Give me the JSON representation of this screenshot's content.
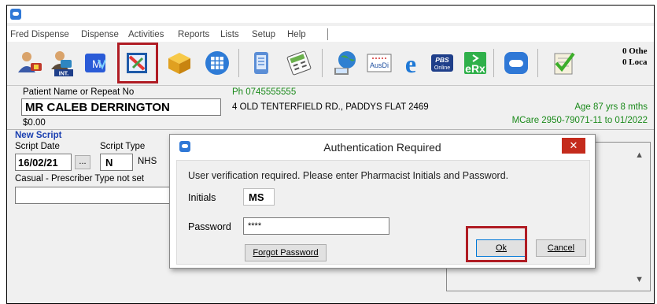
{
  "menu": [
    "Fred Dispense",
    "Dispense",
    "Activities",
    "Reports",
    "Lists",
    "Setup",
    "Help"
  ],
  "toolbar": {
    "icons": [
      {
        "name": "dispense-icon"
      },
      {
        "name": "int-dispense-icon",
        "label": "INT."
      },
      {
        "name": "my-health-record-icon",
        "label": "M"
      },
      {
        "name": "label-print-icon"
      },
      {
        "name": "stock-box-icon"
      },
      {
        "name": "grid-calendar-icon"
      },
      {
        "name": "phone-list-icon"
      },
      {
        "name": "calculator-icon"
      },
      {
        "name": "globe-user-icon"
      },
      {
        "name": "ausdi-icon",
        "label": "AusDi"
      },
      {
        "name": "internet-explorer-icon",
        "label": "e"
      },
      {
        "name": "pbs-online-icon",
        "label": "PBS Online"
      },
      {
        "name": "erx-icon",
        "label": "eRx"
      },
      {
        "name": "fred-logo-icon"
      },
      {
        "name": "checklist-icon"
      }
    ],
    "count1": "0 Othe",
    "count2": "0 Loca"
  },
  "patient": {
    "name_label": "Patient Name or Repeat No",
    "name": "MR CALEB DERRINGTON",
    "balance": "$0.00",
    "phone": "Ph 0745555555",
    "address": "4 OLD TENTERFIELD RD., PADDYS FLAT 2469",
    "age": "Age 87 yrs 8 mths",
    "medicare": "MCare 2950-79071-11  to 01/2022"
  },
  "script": {
    "heading": "New Script",
    "date_label": "Script Date",
    "type_label": "Script Type",
    "date": "16/02/21",
    "browse": "...",
    "type": "N",
    "type_suffix": "NHS",
    "prescriber": "Casual - Prescriber Type not set"
  },
  "dialog": {
    "title": "Authentication Required",
    "close": "✕",
    "message": "User verification required. Please enter Pharmacist Initials and Password.",
    "initials_label": "Initials",
    "initials_value": "MS",
    "password_label": "Password",
    "password_value": "****",
    "forgot": "Forgot Password",
    "ok": "Ok",
    "cancel": "Cancel"
  },
  "colors": {
    "highlight": "#b01c24",
    "accent": "#2f78d6",
    "green_text": "#1b8a1b",
    "close": "#c42b1c"
  }
}
